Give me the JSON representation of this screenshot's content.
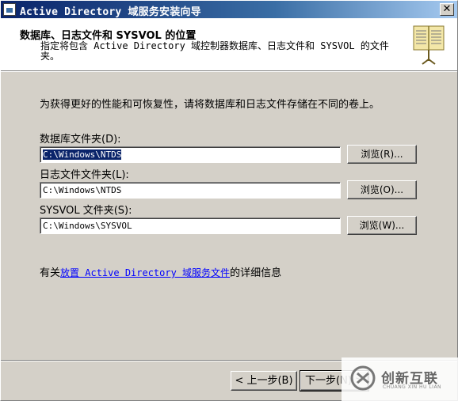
{
  "window": {
    "title": "Active Directory 域服务安装向导",
    "close_glyph": "✕"
  },
  "header": {
    "title": "数据库、日志文件和 SYSVOL 的位置",
    "subtitle": "指定将包含 Active Directory 域控制器数据库、日志文件和 SYSVOL 的文件夹。",
    "icon": "book-icon"
  },
  "intro": "为获得更好的性能和可恢复性，请将数据库和日志文件存储在不同的卷上。",
  "fields": [
    {
      "label": "数据库文件夹(D):",
      "value": "C:\\Windows\\NTDS",
      "button": "浏览(R)..."
    },
    {
      "label": "日志文件文件夹(L):",
      "value": "C:\\Windows\\NTDS",
      "button": "浏览(O)..."
    },
    {
      "label": "SYSVOL 文件夹(S):",
      "value": "C:\\Windows\\SYSVOL",
      "button": "浏览(W)..."
    }
  ],
  "info": {
    "prefix": "有关",
    "link": "放置 Active Directory 域服务文件",
    "suffix": "的详细信息"
  },
  "nav": {
    "back": "< 上一步(B)",
    "next": "下一步(N) >"
  },
  "watermark": {
    "name": "创新互联",
    "sub": "CHUANG XIN HU LIAN"
  }
}
